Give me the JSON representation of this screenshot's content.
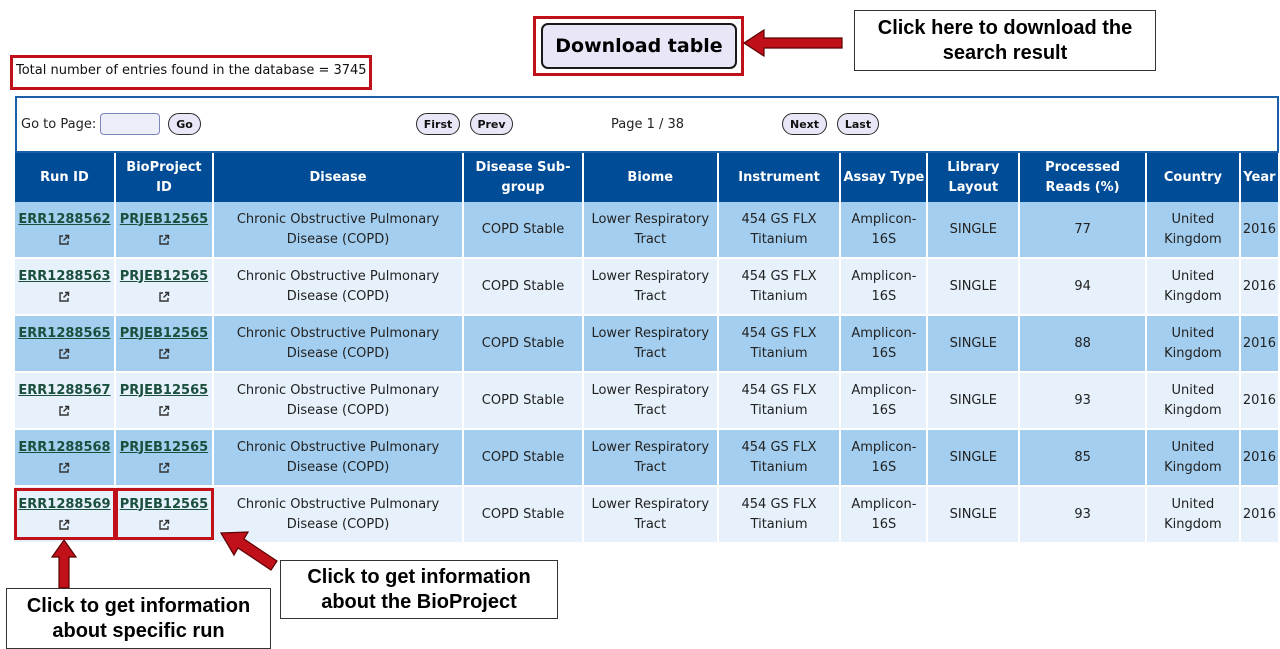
{
  "summary": {
    "total_text": "Total number of entries found in the database = 3745"
  },
  "toolbar": {
    "download_label": "Download table"
  },
  "callouts": {
    "download": "Click here to download the search result",
    "bioproject": "Click to get information about the BioProject",
    "run": "Click to get information about specific run"
  },
  "pagination": {
    "goto_label": "Go to Page:",
    "go_label": "Go",
    "first_label": "First",
    "prev_label": "Prev",
    "page_info": "Page 1 / 38",
    "next_label": "Next",
    "last_label": "Last"
  },
  "table": {
    "columns": [
      "Run ID",
      "BioProject ID",
      "Disease",
      "Disease Sub-group",
      "Biome",
      "Instrument",
      "Assay Type",
      "Library Layout",
      "Processed Reads (%)",
      "Country",
      "Year"
    ],
    "rows": [
      {
        "run_id": "ERR1288562",
        "bioproject_id": "PRJEB12565",
        "disease": "Chronic Obstructive Pulmonary Disease (COPD)",
        "subgroup": "COPD Stable",
        "biome": "Lower Respiratory Tract",
        "instrument": "454 GS FLX Titanium",
        "assay": "Amplicon-16S",
        "layout": "SINGLE",
        "reads": "77",
        "country": "United Kingdom",
        "year": "2016"
      },
      {
        "run_id": "ERR1288563",
        "bioproject_id": "PRJEB12565",
        "disease": "Chronic Obstructive Pulmonary Disease (COPD)",
        "subgroup": "COPD Stable",
        "biome": "Lower Respiratory Tract",
        "instrument": "454 GS FLX Titanium",
        "assay": "Amplicon-16S",
        "layout": "SINGLE",
        "reads": "94",
        "country": "United Kingdom",
        "year": "2016"
      },
      {
        "run_id": "ERR1288565",
        "bioproject_id": "PRJEB12565",
        "disease": "Chronic Obstructive Pulmonary Disease (COPD)",
        "subgroup": "COPD Stable",
        "biome": "Lower Respiratory Tract",
        "instrument": "454 GS FLX Titanium",
        "assay": "Amplicon-16S",
        "layout": "SINGLE",
        "reads": "88",
        "country": "United Kingdom",
        "year": "2016"
      },
      {
        "run_id": "ERR1288567",
        "bioproject_id": "PRJEB12565",
        "disease": "Chronic Obstructive Pulmonary Disease (COPD)",
        "subgroup": "COPD Stable",
        "biome": "Lower Respiratory Tract",
        "instrument": "454 GS FLX Titanium",
        "assay": "Amplicon-16S",
        "layout": "SINGLE",
        "reads": "93",
        "country": "United Kingdom",
        "year": "2016"
      },
      {
        "run_id": "ERR1288568",
        "bioproject_id": "PRJEB12565",
        "disease": "Chronic Obstructive Pulmonary Disease (COPD)",
        "subgroup": "COPD Stable",
        "biome": "Lower Respiratory Tract",
        "instrument": "454 GS FLX Titanium",
        "assay": "Amplicon-16S",
        "layout": "SINGLE",
        "reads": "85",
        "country": "United Kingdom",
        "year": "2016"
      },
      {
        "run_id": "ERR1288569",
        "bioproject_id": "PRJEB12565",
        "disease": "Chronic Obstructive Pulmonary Disease (COPD)",
        "subgroup": "COPD Stable",
        "biome": "Lower Respiratory Tract",
        "instrument": "454 GS FLX Titanium",
        "assay": "Amplicon-16S",
        "layout": "SINGLE",
        "reads": "93",
        "country": "United Kingdom",
        "year": "2016"
      }
    ]
  },
  "icons": {
    "external_link": "external-link-icon",
    "arrow": "red-arrow-icon"
  },
  "colors": {
    "highlight": "#c0101a",
    "header": "#004c97",
    "row_dark": "#a4ceef",
    "row_light": "#e6f1fb",
    "link": "#1b4f3d"
  }
}
